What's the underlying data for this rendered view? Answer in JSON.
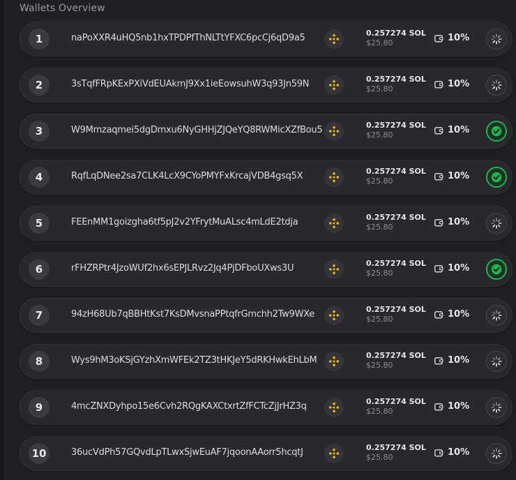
{
  "title": "Wallets Overview",
  "wallets": [
    {
      "index": "1",
      "address": "naPoXXR4uHQ5nb1hxTPDPfThNLTtYFXC6pcCj6qD9a5",
      "sol": "0.257274 SOL",
      "usd": "$25.80",
      "percent": "10%",
      "status": "loading"
    },
    {
      "index": "2",
      "address": "3sTqfFRpKExPXiVdEUAkmJ9Xx1ieEowsuhW3q93Jn59N",
      "sol": "0.257274 SOL",
      "usd": "$25.80",
      "percent": "10%",
      "status": "loading"
    },
    {
      "index": "3",
      "address": "W9Mmzaqmei5dgDmxu6NyGHHjZJQeYQ8RWMicXZfBou5",
      "sol": "0.257274 SOL",
      "usd": "$25.80",
      "percent": "10%",
      "status": "done"
    },
    {
      "index": "4",
      "address": "RqfLqDNee2sa7CLK4LcX9CYoPMYFxKrcajVDB4gsq5X",
      "sol": "0.257274 SOL",
      "usd": "$25.80",
      "percent": "10%",
      "status": "done"
    },
    {
      "index": "5",
      "address": "FEEnMM1goizgha6tf5pJ2v2YFrytMuALsc4mLdE2tdja",
      "sol": "0.257274 SOL",
      "usd": "$25.80",
      "percent": "10%",
      "status": "loading"
    },
    {
      "index": "6",
      "address": "rFHZRPtr4JzoWUf2hx6sEPJLRvz2Jq4PjDFboUXws3U",
      "sol": "0.257274 SOL",
      "usd": "$25.80",
      "percent": "10%",
      "status": "done"
    },
    {
      "index": "7",
      "address": "94zH68Ub7qBBHtKst7KsDMvsnaPPtqfrGmchh2Tw9WXe",
      "sol": "0.257274 SOL",
      "usd": "$25.80",
      "percent": "10%",
      "status": "loading"
    },
    {
      "index": "8",
      "address": "Wys9hM3oKSjGYzhXmWFEk2TZ3tHKJeY5dRKHwkEhLbM",
      "sol": "0.257274 SOL",
      "usd": "$25.80",
      "percent": "10%",
      "status": "loading"
    },
    {
      "index": "9",
      "address": "4mcZNXDyhpo15e6Cvh2RQgKAXCtxrtZfFCTcZjJrHZ3q",
      "sol": "0.257274 SOL",
      "usd": "$25.80",
      "percent": "10%",
      "status": "loading"
    },
    {
      "index": "10",
      "address": "36ucVdPh57GQvdLpTLwxSjwEuAF7jqoonAAorr5hcqtJ",
      "sol": "0.257274 SOL",
      "usd": "$25.80",
      "percent": "10%",
      "status": "loading"
    }
  ],
  "icons": {
    "chain": "bnb-diamond-icon",
    "percent": "wallet-icon",
    "status_loading": "spinner-icon",
    "status_done": "check-circle-icon"
  },
  "colors": {
    "background": "#1b1b1e",
    "row": "#29292d",
    "accent_gold": "#f0b90b",
    "success_green": "#25b052"
  }
}
